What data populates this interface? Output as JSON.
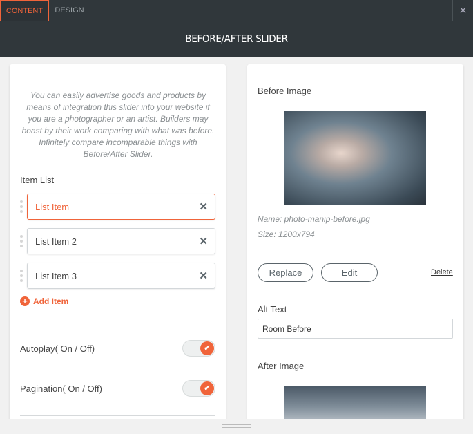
{
  "tabs": {
    "content": "CONTENT",
    "design": "DESIGN"
  },
  "close_icon": "×",
  "title": "BEFORE/AFTER SLIDER",
  "description": "You can easily advertise goods and products by means of integration this slider into your website if you are a photographer or an artist. Builders may boast by their work comparing with what was before. Infinitely compare incomparable things with Before/After Slider.",
  "item_list": {
    "label": "Item List",
    "items": [
      {
        "label": "List Item"
      },
      {
        "label": "List Item 2"
      },
      {
        "label": "List Item 3"
      }
    ],
    "add": "Add Item",
    "remove_icon": "✕"
  },
  "toggles": {
    "autoplay": {
      "label": "Autoplay( On / Off)",
      "on": true
    },
    "pagination": {
      "label": "Pagination( On / Off)",
      "on": true
    }
  },
  "before": {
    "label": "Before Image",
    "name": "Name: photo-manip-before.jpg",
    "size": "Size: 1200x794",
    "replace": "Replace",
    "edit": "Edit",
    "delete": "Delete"
  },
  "alt": {
    "label": "Alt Text",
    "value": "Room Before"
  },
  "after": {
    "label": "After Image"
  },
  "colors": {
    "accent": "#f0643a",
    "header": "#30373b"
  }
}
